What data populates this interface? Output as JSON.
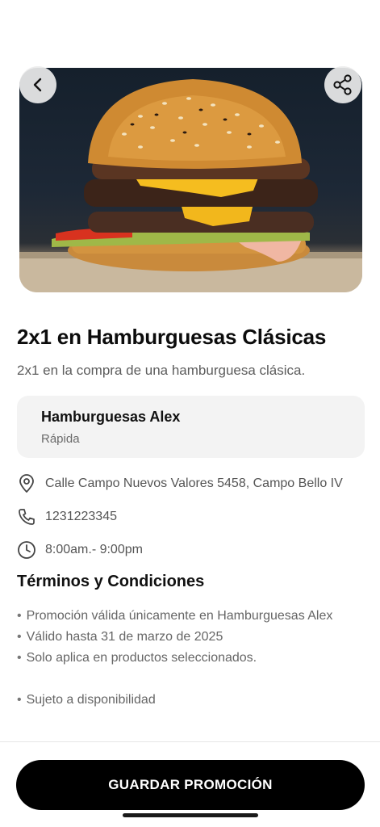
{
  "promo": {
    "image_alt": "hamburger-photo",
    "title": "2x1 en Hamburguesas Clásicas",
    "description": "2x1 en la compra de una hamburguesa clásica."
  },
  "merchant": {
    "name": "Hamburguesas Alex",
    "category": "Rápida"
  },
  "info": {
    "address": "Calle Campo Nuevos Valores 5458, Campo Bello IV",
    "phone": "1231223345",
    "hours": "8:00am.- 9:00pm"
  },
  "terms": {
    "title": "Términos y Condiciones",
    "items": [
      "Promoción válida únicamente en Hamburguesas Alex",
      "Válido hasta 31 de marzo de 2025",
      "Solo aplica en productos seleccionados.",
      "Sujeto a disponibilidad"
    ]
  },
  "actions": {
    "save_label": "GUARDAR PROMOCIÓN"
  },
  "icons": {
    "back": "chevron-left-icon",
    "share": "share-icon",
    "address": "location-pin-icon",
    "phone": "phone-icon",
    "hours": "clock-icon"
  },
  "colors": {
    "primary_button": "#000000",
    "card_background": "#f3f3f3"
  }
}
